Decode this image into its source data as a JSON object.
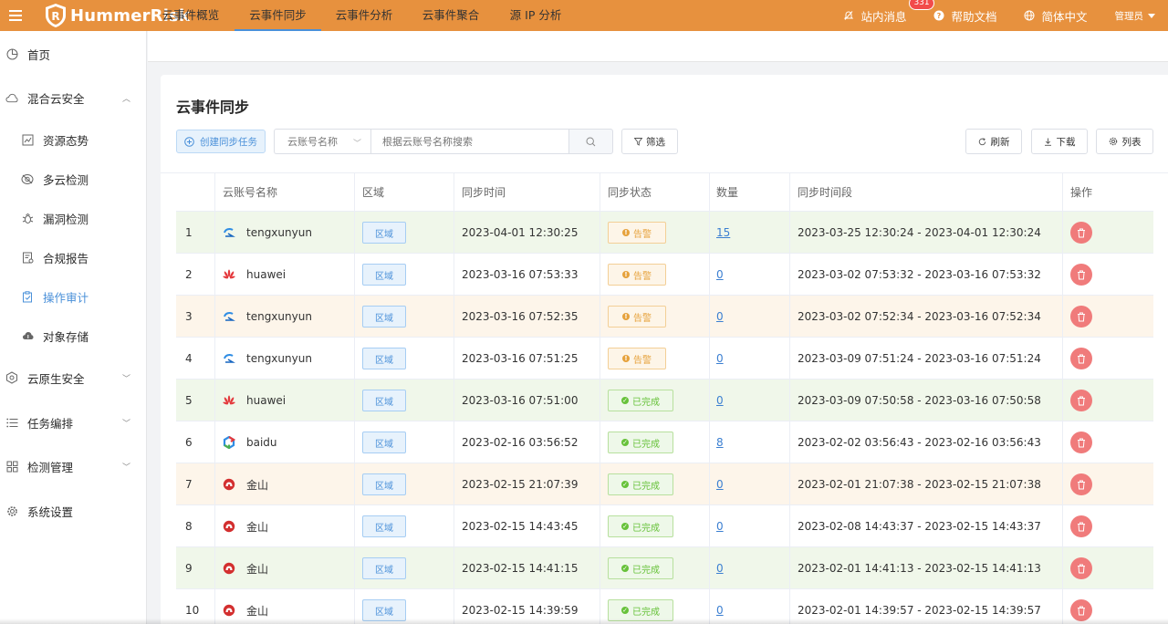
{
  "header": {
    "brand": "HummerRisk",
    "messages_label": "站内消息",
    "messages_badge": "331",
    "help_label": "帮助文档",
    "lang_label": "简体中文",
    "user_label": "管理员"
  },
  "sidebar": {
    "items": [
      {
        "label": "首页",
        "icon": "pie-chart-icon"
      },
      {
        "label": "混合云安全",
        "icon": "cloud-icon",
        "expanded": true
      },
      {
        "label": "资源态势",
        "icon": "chart-icon"
      },
      {
        "label": "多云检测",
        "icon": "radar-icon"
      },
      {
        "label": "漏洞检测",
        "icon": "bug-icon"
      },
      {
        "label": "合规报告",
        "icon": "report-icon"
      },
      {
        "label": "操作审计",
        "icon": "audit-icon",
        "active": true
      },
      {
        "label": "对象存储",
        "icon": "storage-icon"
      },
      {
        "label": "云原生安全",
        "icon": "hexagon-icon"
      },
      {
        "label": "任务编排",
        "icon": "list-icon"
      },
      {
        "label": "检测管理",
        "icon": "grid-icon"
      },
      {
        "label": "系统设置",
        "icon": "gear-icon"
      }
    ]
  },
  "tabs": [
    {
      "label": "云事件概览"
    },
    {
      "label": "云事件同步",
      "active": true
    },
    {
      "label": "云事件分析"
    },
    {
      "label": "云事件聚合"
    },
    {
      "label": "源 IP 分析"
    }
  ],
  "page": {
    "title": "云事件同步",
    "create_label": "创建同步任务",
    "select_label": "云账号名称",
    "search_placeholder": "根据云账号名称搜索",
    "filter_label": "筛选",
    "refresh_label": "刷新",
    "download_label": "下载",
    "columns_label": "列表"
  },
  "table": {
    "columns": [
      "云账号名称",
      "区域",
      "同步时间",
      "同步状态",
      "数量",
      "同步时间段",
      "操作"
    ],
    "rows": [
      {
        "no": "1",
        "account": "tengxunyun",
        "provider": "tencent",
        "region": "区域",
        "time": "2023-04-01 12:30:25",
        "status": "告警",
        "status_type": "warn",
        "count": "15",
        "period": "2023-03-25 12:30:24 - 2023-04-01 12:30:24",
        "bg": "#f0f7ea"
      },
      {
        "no": "2",
        "account": "huawei",
        "provider": "huawei",
        "region": "区域",
        "time": "2023-03-16 07:53:33",
        "status": "告警",
        "status_type": "warn",
        "count": "0",
        "period": "2023-03-02 07:53:32 - 2023-03-16 07:53:32",
        "bg": "#ffffff"
      },
      {
        "no": "3",
        "account": "tengxunyun",
        "provider": "tencent",
        "region": "区域",
        "time": "2023-03-16 07:52:35",
        "status": "告警",
        "status_type": "warn",
        "count": "0",
        "period": "2023-03-02 07:52:34 - 2023-03-16 07:52:34",
        "bg": "#fdf5ea"
      },
      {
        "no": "4",
        "account": "tengxunyun",
        "provider": "tencent",
        "region": "区域",
        "time": "2023-03-16 07:51:25",
        "status": "告警",
        "status_type": "warn",
        "count": "0",
        "period": "2023-03-09 07:51:24 - 2023-03-16 07:51:24",
        "bg": "#ffffff"
      },
      {
        "no": "5",
        "account": "huawei",
        "provider": "huawei",
        "region": "区域",
        "time": "2023-03-16 07:51:00",
        "status": "已完成",
        "status_type": "done",
        "count": "0",
        "period": "2023-03-09 07:50:58 - 2023-03-16 07:50:58",
        "bg": "#f0f7ea"
      },
      {
        "no": "6",
        "account": "baidu",
        "provider": "baidu",
        "region": "区域",
        "time": "2023-02-16 03:56:52",
        "status": "已完成",
        "status_type": "done",
        "count": "8",
        "period": "2023-02-02 03:56:43 - 2023-02-16 03:56:43",
        "bg": "#ffffff"
      },
      {
        "no": "7",
        "account": "金山",
        "provider": "kingsoft",
        "region": "区域",
        "time": "2023-02-15 21:07:39",
        "status": "已完成",
        "status_type": "done",
        "count": "0",
        "period": "2023-02-01 21:07:38 - 2023-02-15 21:07:38",
        "bg": "#fdf5ea"
      },
      {
        "no": "8",
        "account": "金山",
        "provider": "kingsoft",
        "region": "区域",
        "time": "2023-02-15 14:43:45",
        "status": "已完成",
        "status_type": "done",
        "count": "0",
        "period": "2023-02-08 14:43:37 - 2023-02-15 14:43:37",
        "bg": "#ffffff"
      },
      {
        "no": "9",
        "account": "金山",
        "provider": "kingsoft",
        "region": "区域",
        "time": "2023-02-15 14:41:15",
        "status": "已完成",
        "status_type": "done",
        "count": "0",
        "period": "2023-02-01 14:41:13 - 2023-02-15 14:41:13",
        "bg": "#f0f7ea"
      },
      {
        "no": "10",
        "account": "金山",
        "provider": "kingsoft",
        "region": "区域",
        "time": "2023-02-15 14:39:59",
        "status": "已完成",
        "status_type": "done",
        "count": "0",
        "period": "2023-02-01 14:39:57 - 2023-02-15 14:39:57",
        "bg": "#ffffff"
      }
    ]
  },
  "colors": {
    "header_bg": "#e7913e",
    "accent": "#4a90d9",
    "warn": "#e6a23c",
    "done": "#67c23a",
    "delete": "#f07b7b"
  }
}
